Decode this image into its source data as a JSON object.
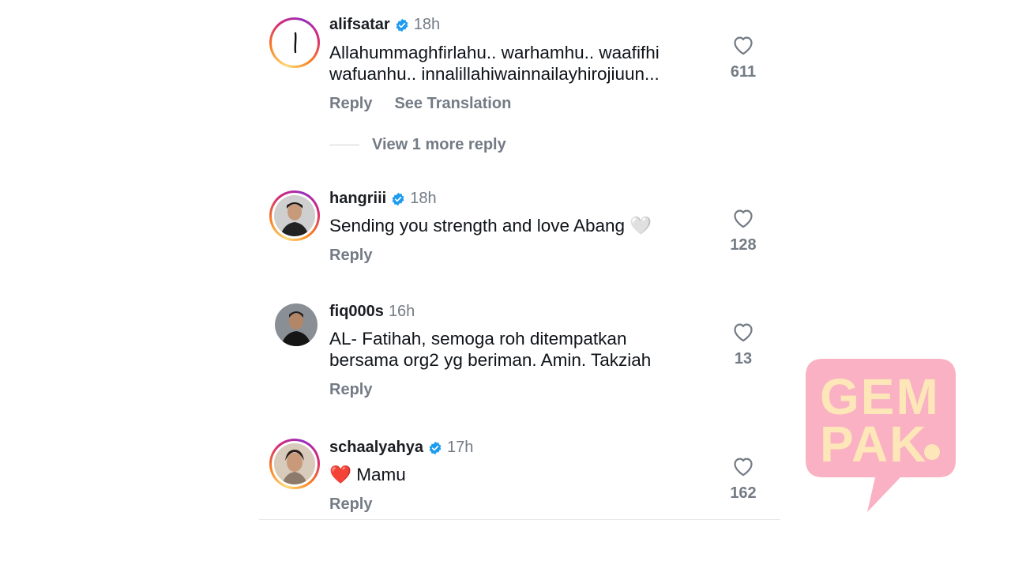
{
  "comments": [
    {
      "username": "alifsatar",
      "verified": true,
      "time": "18h",
      "text": "Allahummaghfirlahu.. warhamhu.. waafifhi wafuanhu.. innalillahiwainnailayhirojiuun...",
      "actions": [
        "Reply",
        "See Translation"
      ],
      "likes": "611",
      "avatar": "story-ring-logo",
      "more_replies": "View 1 more reply"
    },
    {
      "username": "hangriii",
      "verified": true,
      "time": "18h",
      "text": "Sending you strength and love Abang 🤍",
      "actions": [
        "Reply"
      ],
      "likes": "128",
      "avatar": "story-ring-photo"
    },
    {
      "username": "fiq000s",
      "verified": false,
      "time": "16h",
      "text": "AL- Fatihah, semoga roh ditempatkan bersama org2 yg beriman. Amin. Takziah",
      "actions": [
        "Reply"
      ],
      "likes": "13",
      "avatar": "photo"
    },
    {
      "username": "schaalyahya",
      "verified": true,
      "time": "17h",
      "text": "❤️ Mamu",
      "actions": [
        "Reply"
      ],
      "likes": "162",
      "avatar": "story-ring-photo"
    }
  ],
  "colors": {
    "verified": "#1d9bf0",
    "muted": "#737b85",
    "watermark": "#f9a3b8"
  },
  "watermark": {
    "line1": "GEM",
    "line2": "PAK"
  }
}
